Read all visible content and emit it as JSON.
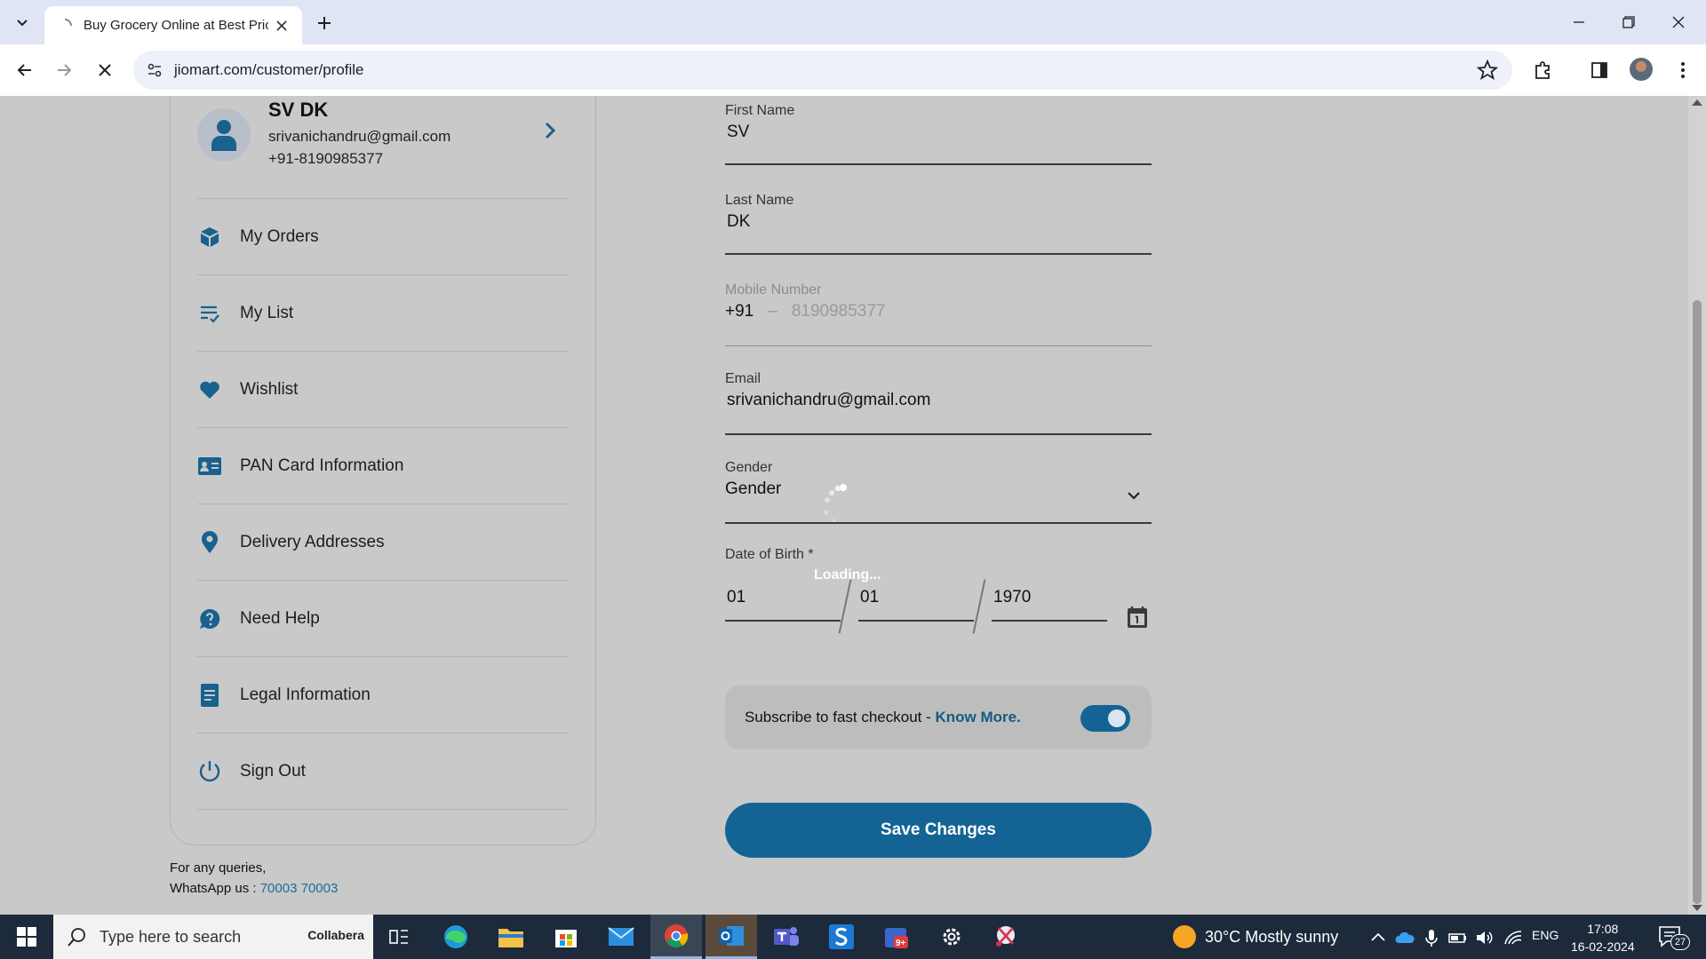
{
  "browser": {
    "tab_title": "Buy Grocery Online at Best Price",
    "url": "jiomart.com/customer/profile"
  },
  "profile": {
    "name": "SV DK",
    "email": "srivanichandru@gmail.com",
    "phone": "+91-8190985377"
  },
  "menu": {
    "items": [
      {
        "label": "My Orders",
        "icon": "box-icon"
      },
      {
        "label": "My List",
        "icon": "list-check-icon"
      },
      {
        "label": "Wishlist",
        "icon": "heart-icon"
      },
      {
        "label": "PAN Card Information",
        "icon": "id-card-icon"
      },
      {
        "label": "Delivery Addresses",
        "icon": "location-pin-icon"
      },
      {
        "label": "Need Help",
        "icon": "help-icon"
      },
      {
        "label": "Legal Information",
        "icon": "document-icon"
      },
      {
        "label": "Sign Out",
        "icon": "power-icon"
      }
    ]
  },
  "queries": {
    "line1": "For any queries,",
    "whatsapp_label": "WhatsApp us : ",
    "whatsapp_number": "70003 70003"
  },
  "form": {
    "first_name_label": "First Name",
    "first_name_value": "SV",
    "last_name_label": "Last Name",
    "last_name_value": "DK",
    "mobile_label": "Mobile Number",
    "mobile_cc": "+91",
    "mobile_sep": "–",
    "mobile_value": "8190985377",
    "email_label": "Email",
    "email_value": "srivanichandru@gmail.com",
    "gender_label": "Gender",
    "gender_value": "Gender",
    "dob_label": "Date of Birth",
    "dob_required": "*",
    "dob_day": "01",
    "dob_month": "01",
    "dob_year": "1970",
    "loading_text": "Loading...",
    "subscribe_text": "Subscribe to fast checkout - ",
    "subscribe_link": "Know More.",
    "subscribe_on": true,
    "save_button": "Save Changes"
  },
  "taskbar": {
    "search_placeholder": "Type here to search",
    "search_brand": "Collabera",
    "weather": "30°C  Mostly sunny",
    "language": "ENG",
    "time": "17:08",
    "date": "16-02-2024",
    "notification_count": "27"
  },
  "colors": {
    "accent": "#136495",
    "link": "#1b6d9c",
    "overlay_bg": "#c9c9c9"
  }
}
